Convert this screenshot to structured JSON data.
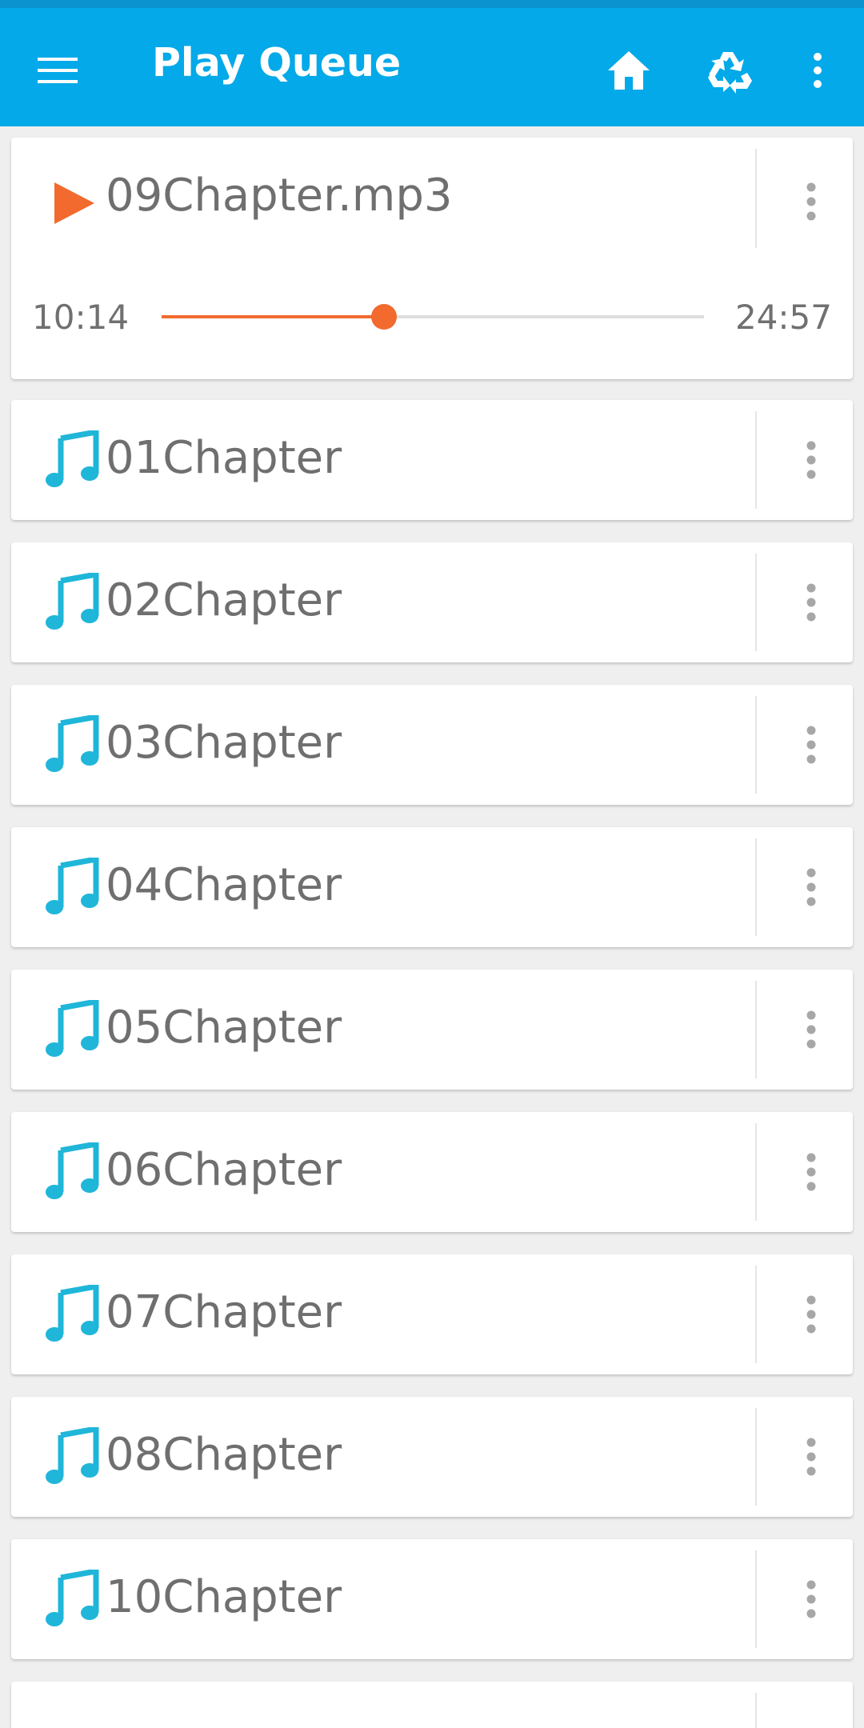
{
  "app_bar": {
    "title": "Play Queue",
    "icons": [
      "menu-icon",
      "home-icon",
      "recycle-icon",
      "overflow-menu-icon"
    ],
    "color": "#03a9e8"
  },
  "now_playing": {
    "title": "09Chapter.mp3",
    "elapsed": "10:14",
    "total": "24:57",
    "progress": 0.41,
    "accent": "#f26a2e"
  },
  "queue": [
    {
      "title": "01Chapter"
    },
    {
      "title": "02Chapter"
    },
    {
      "title": "03Chapter"
    },
    {
      "title": "04Chapter"
    },
    {
      "title": "05Chapter"
    },
    {
      "title": "06Chapter"
    },
    {
      "title": "07Chapter"
    },
    {
      "title": "08Chapter"
    },
    {
      "title": "10Chapter"
    },
    {
      "title": ""
    }
  ],
  "note_color": "#1fb6d9"
}
